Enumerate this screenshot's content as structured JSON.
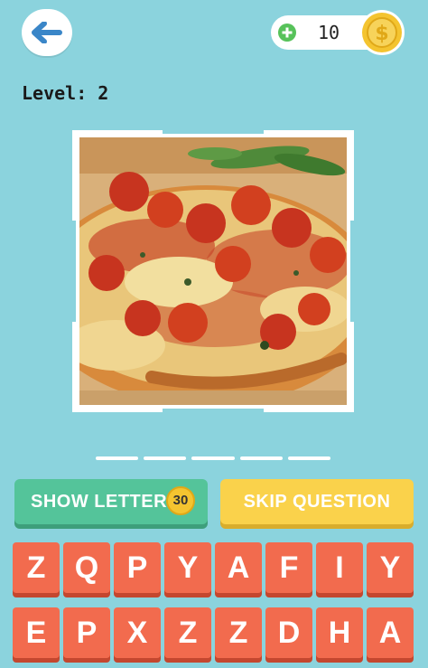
{
  "header": {
    "coin_count": "10"
  },
  "level": {
    "label": "Level: 2"
  },
  "answer": {
    "slot_count": 5
  },
  "actions": {
    "hint_label": "SHOW LETTER",
    "hint_cost": "30",
    "skip_label": "SKIP QUESTION"
  },
  "keyboard": {
    "row1": [
      "Z",
      "Q",
      "P",
      "Y",
      "A",
      "F",
      "I",
      "Y"
    ],
    "row2": [
      "E",
      "P",
      "X",
      "Z",
      "Z",
      "D",
      "H",
      "A"
    ]
  },
  "colors": {
    "background": "#8bd3dd",
    "key": "#f26b4e",
    "hint_button": "#54c49a",
    "skip_button": "#fad24b",
    "coin": "#f4c430"
  }
}
